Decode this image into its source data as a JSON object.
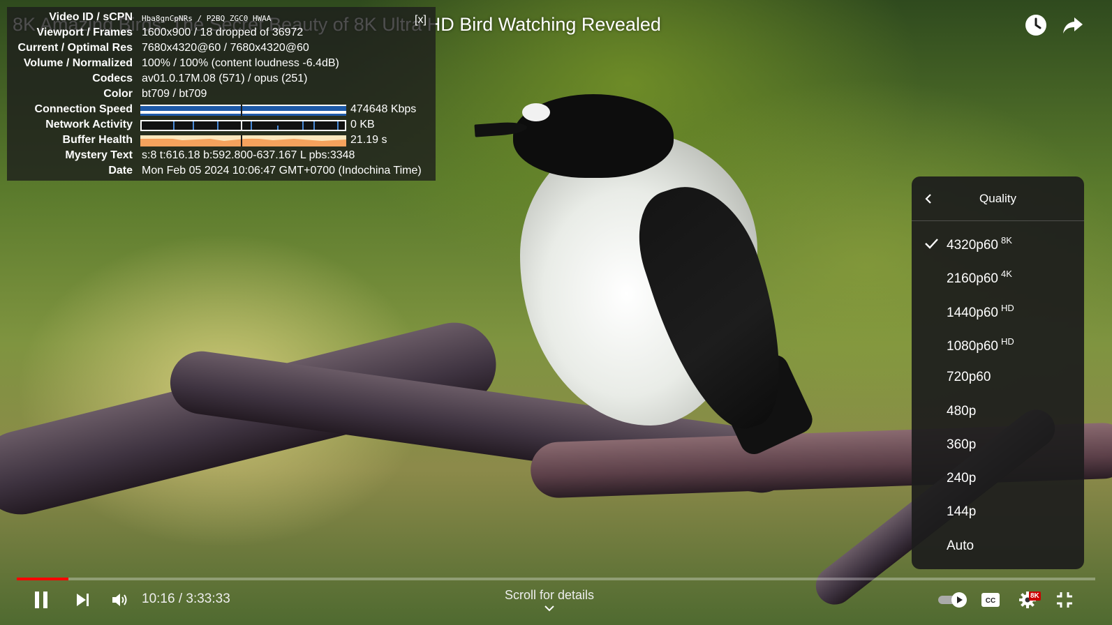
{
  "video": {
    "title": "8K Amazing Birds: The Secret Beauty of 8K Ultra HD Bird Watching Revealed"
  },
  "top_actions": {
    "watch_later_icon": "clock-icon",
    "share_icon": "share-icon"
  },
  "stats": {
    "close_label": "[x]",
    "rows": {
      "video_id": {
        "label": "Video ID / sCPN",
        "value": "Hba8gnCpNRs / P2BQ ZGC0 HWAA"
      },
      "viewport": {
        "label": "Viewport / Frames",
        "value": "1600x900 / 18 dropped of 36972"
      },
      "resolution": {
        "label": "Current / Optimal Res",
        "value": "7680x4320@60 / 7680x4320@60"
      },
      "volume": {
        "label": "Volume / Normalized",
        "value": "100% / 100% (content loudness -6.4dB)"
      },
      "codecs": {
        "label": "Codecs",
        "value": "av01.0.17M.08 (571) / opus (251)"
      },
      "color": {
        "label": "Color",
        "value": "bt709 / bt709"
      },
      "connection": {
        "label": "Connection Speed",
        "value": "474648 Kbps"
      },
      "network": {
        "label": "Network Activity",
        "value": "0 KB"
      },
      "buffer": {
        "label": "Buffer Health",
        "value": "21.19 s"
      },
      "mystery": {
        "label": "Mystery Text",
        "value": "s:8 t:616.18 b:592.800-637.167 L pbs:3348"
      },
      "date": {
        "label": "Date",
        "value": "Mon Feb 05 2024 10:06:47 GMT+0700 (Indochina Time)"
      }
    }
  },
  "quality_menu": {
    "title": "Quality",
    "back_icon": "chevron-left-icon",
    "selected": "4320p60",
    "items": [
      {
        "label": "4320p60",
        "badge": "8K"
      },
      {
        "label": "2160p60",
        "badge": "4K"
      },
      {
        "label": "1440p60",
        "badge": "HD"
      },
      {
        "label": "1080p60",
        "badge": "HD"
      },
      {
        "label": "720p60",
        "badge": ""
      },
      {
        "label": "480p",
        "badge": ""
      },
      {
        "label": "360p",
        "badge": ""
      },
      {
        "label": "240p",
        "badge": ""
      },
      {
        "label": "144p",
        "badge": ""
      },
      {
        "label": "Auto",
        "badge": ""
      }
    ]
  },
  "controls": {
    "time": "10:16 / 3:33:33",
    "progress": 0.048,
    "scroll_hint": "Scroll for details",
    "settings_badge": "8K",
    "icons": {
      "pause": "pause-icon",
      "next": "next-icon",
      "volume": "volume-icon",
      "autoplay": "autoplay-toggle-icon",
      "captions": "captions-icon",
      "settings": "gear-icon",
      "fullscreen_exit": "fullscreen-exit-icon"
    }
  },
  "colors": {
    "progress": "#ff0000",
    "badge": "#cc0000",
    "connection_bar": "#1e5aa8",
    "buffer_bar": "#f5a25d"
  }
}
